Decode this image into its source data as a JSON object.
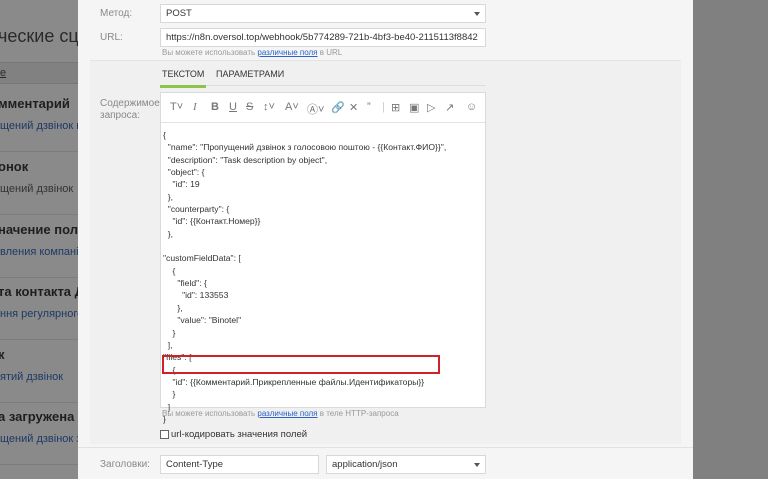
{
  "background": {
    "page_title": "ческие сце",
    "column_header": "е",
    "rows": [
      {
        "title": "мментарий",
        "link": "щений дзвінок new"
      },
      {
        "title": "онок",
        "link": "щений дзвінок"
      },
      {
        "title": "начение поля: О",
        "link": "вления компанії в"
      },
      {
        "title": "та контакта Да",
        "link": "ння регулярного з"
      },
      {
        "title": "к",
        "link": "ятий дзвінок"
      },
      {
        "title": "а загружена",
        "link": "щений дзвінок з г"
      }
    ]
  },
  "modal": {
    "method_label": "Метод:",
    "method_value": "POST",
    "url_label": "URL:",
    "url_value": "https://n8n.oversol.top/webhook/5b774289-721b-4bf3-be40-2115113f8842",
    "url_hint_prefix": "Вы можете использовать ",
    "url_hint_link": "различные поля",
    "url_hint_suffix": " в URL",
    "tabs": [
      {
        "label": "ТЕКСТОМ"
      },
      {
        "label": "ПАРАМЕТРАМИ"
      }
    ],
    "body_label_line1": "Содержимое",
    "body_label_line2": "запроса:",
    "toolbar_icons": [
      "text-format-icon",
      "italic-icon",
      "bold-icon",
      "underline-icon",
      "strikethrough-icon",
      "font-size-icon",
      "text-color-icon",
      "emoji-face-icon",
      "link-icon",
      "eraser-icon",
      "quote-icon",
      "table-icon",
      "image-icon",
      "video-icon",
      "insert-icon",
      "smile-icon"
    ],
    "code_lines": [
      "{",
      "  \"name\": \"Пропущений дзвінок з голосовою поштою - {{Контакт.ФИО}}\",",
      "  \"description\": \"Task description by object\",",
      "  \"object\": {",
      "    \"id\": 19",
      "  },",
      "  \"counterparty\": {",
      "    \"id\": {{Контакт.Номер}}",
      "  },",
      "",
      "\"customFieldData\": [",
      "    {",
      "      \"field\": {",
      "        \"id\": 133553",
      "      },",
      "      \"value\": \"Binotel\"",
      "    }",
      "  ],",
      "\"files\": [",
      "    {",
      "    \"id\": {{Комментарий.Прикрепленные файлы.Идентификаторы}}",
      "    }",
      "  ]",
      "}"
    ],
    "body_hint_prefix": "Вы можете использовать ",
    "body_hint_link": "различные поля",
    "body_hint_suffix": " в теле HTTP-запроса",
    "urlencode_label": "url-кодировать значения полей",
    "headers_label": "Заголовки:",
    "header_name": "Content-Type",
    "header_value": "application/json"
  }
}
